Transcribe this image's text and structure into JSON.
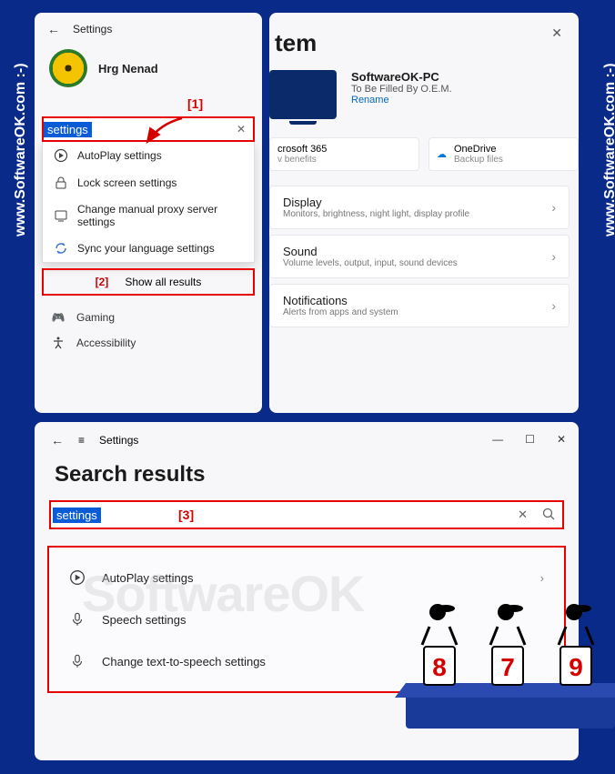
{
  "watermark": "www.SoftwareOK.com :-)",
  "top": {
    "header": "Settings",
    "user_name": "Hrg Nenad",
    "callout1": "[1]",
    "search_value": "settings",
    "suggestions": [
      {
        "icon": "autoplay",
        "label": "AutoPlay settings"
      },
      {
        "icon": "lock",
        "label": "Lock screen settings"
      },
      {
        "icon": "proxy",
        "label": "Change manual proxy server settings"
      },
      {
        "icon": "sync",
        "label": "Sync your language settings"
      }
    ],
    "callout2": "[2]",
    "show_all": "Show all results",
    "nav_gaming": "Gaming",
    "nav_access": "Accessibility"
  },
  "right": {
    "system_partial": "tem",
    "pc_name": "SoftwareOK-PC",
    "pc_sub": "To Be Filled By O.E.M.",
    "rename": "Rename",
    "tile1": "crosoft 365",
    "tile1_sub": "v benefits",
    "tile2": "OneDrive",
    "tile2_sub": "Backup files",
    "cards": [
      {
        "t": "Display",
        "s": "Monitors, brightness, night light, display profile"
      },
      {
        "t": "Sound",
        "s": "Volume levels, output, input, sound devices"
      },
      {
        "t": "Notifications",
        "s": "Alerts from apps and system"
      }
    ]
  },
  "bottom": {
    "header": "Settings",
    "title": "Search results",
    "search_value": "settings",
    "callout3": "[3]",
    "results": [
      {
        "icon": "autoplay",
        "label": "AutoPlay settings",
        "chev": true
      },
      {
        "icon": "mic",
        "label": "Speech settings"
      },
      {
        "icon": "mic",
        "label": "Change text-to-speech settings"
      }
    ]
  },
  "judges": {
    "scores": [
      "8",
      "7",
      "9"
    ]
  }
}
